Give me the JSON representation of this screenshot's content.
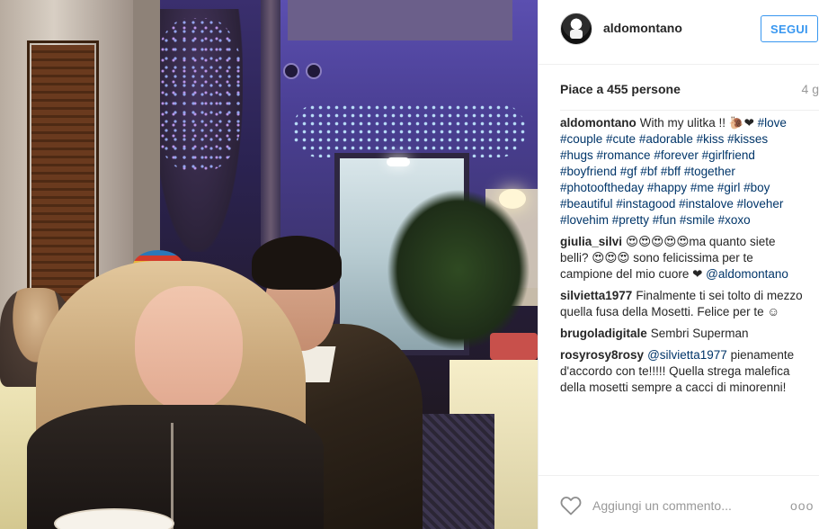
{
  "post": {
    "username": "aldomontano",
    "follow_label": "SEGUI",
    "likes_text": "Piace a 455 persone",
    "time_ago": "4 g"
  },
  "comments": [
    {
      "user": "aldomontano",
      "parts": [
        {
          "type": "text",
          "text": "With my ulitka !! 🐌❤"
        },
        {
          "type": "tag",
          "text": " #love #couple #cute #adorable #kiss #kisses #hugs #romance #forever #girlfriend #boyfriend #gf #bf #bff #together #photooftheday #happy #me #girl #boy #beautiful #instagood #instalove #loveher #lovehim #pretty #fun #smile #xoxo"
        }
      ]
    },
    {
      "user": "giulia_silvi",
      "parts": [
        {
          "type": "text",
          "text": "😍😍😍😍😍ma quanto siete belli? 😍😍😍 sono felicissima per te campione del mio cuore ❤ "
        },
        {
          "type": "tag",
          "text": "@aldomontano"
        }
      ]
    },
    {
      "user": "silvietta1977",
      "parts": [
        {
          "type": "text",
          "text": "Finalmente ti sei tolto di mezzo quella fusa della Mosetti. Felice per te ☺"
        }
      ]
    },
    {
      "user": "brugoladigitale",
      "parts": [
        {
          "type": "text",
          "text": "Sembri Superman"
        }
      ]
    },
    {
      "user": "rosyrosy8rosy",
      "parts": [
        {
          "type": "tag",
          "text": "@silvietta1977"
        },
        {
          "type": "text",
          "text": " pienamente d'accordo con te!!!!! Quella strega malefica della mosetti sempre a cacci di minorenni!"
        }
      ]
    }
  ],
  "footer": {
    "comment_placeholder": "Aggiungi un commento...",
    "more_label": "ooo",
    "like_icon": "heart-outline-icon"
  },
  "colors": {
    "accent": "#3897f0",
    "hashtag": "#003569",
    "muted": "#999999"
  }
}
